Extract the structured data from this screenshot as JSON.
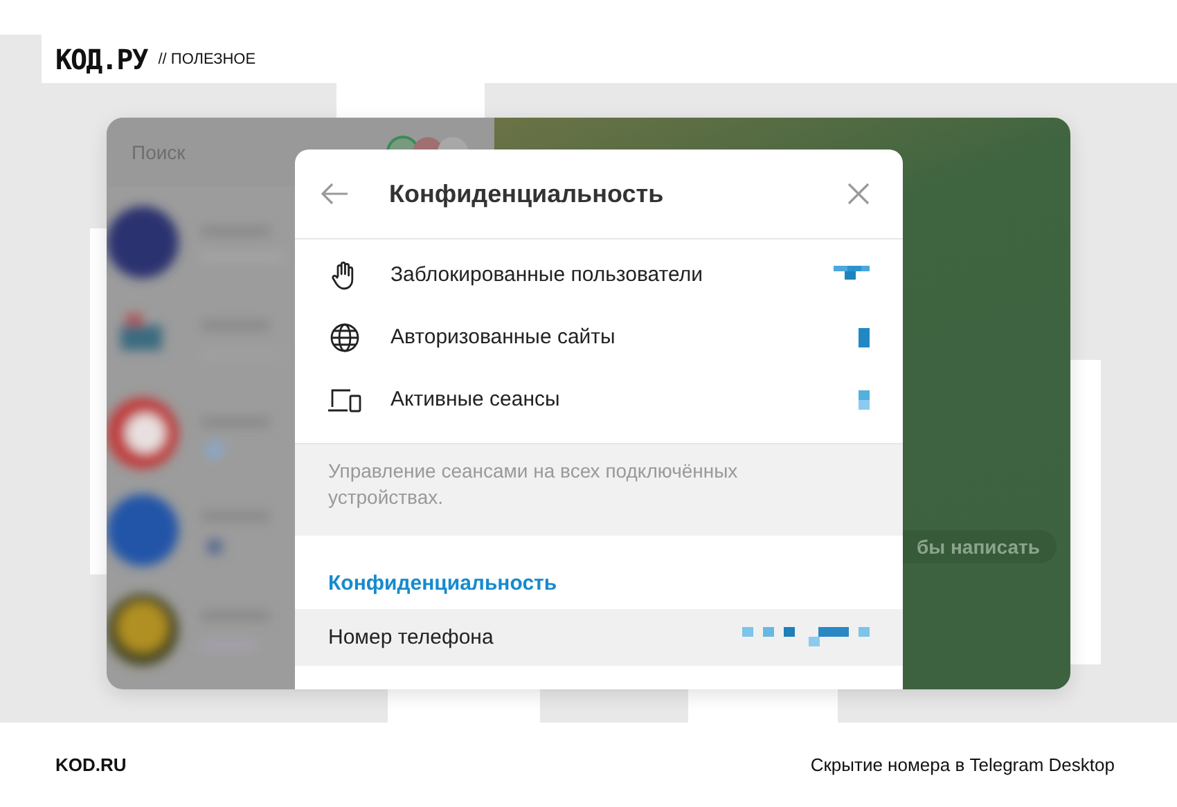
{
  "brand": {
    "logo": "КОД.РУ",
    "section": "// ПОЛЕЗНОЕ"
  },
  "app": {
    "search": {
      "placeholder": "Поиск"
    },
    "chat_bubble": "бы написать",
    "dialog": {
      "title": "Конфиденциальность",
      "items": [
        {
          "kind": "hand",
          "label": "Заблокированные пользователи"
        },
        {
          "kind": "globe",
          "label": "Авторизованные сайты"
        },
        {
          "kind": "devices",
          "label": "Активные сеансы"
        }
      ],
      "note": "Управление сеансами на всех подключённых устройствах.",
      "section_title": "Конфиденциальность",
      "settings": [
        {
          "label": "Номер телефона",
          "highlighted": true
        }
      ]
    }
  },
  "footer": {
    "site": "KOD.RU",
    "caption": "Скрытие номера в Telegram Desktop"
  }
}
